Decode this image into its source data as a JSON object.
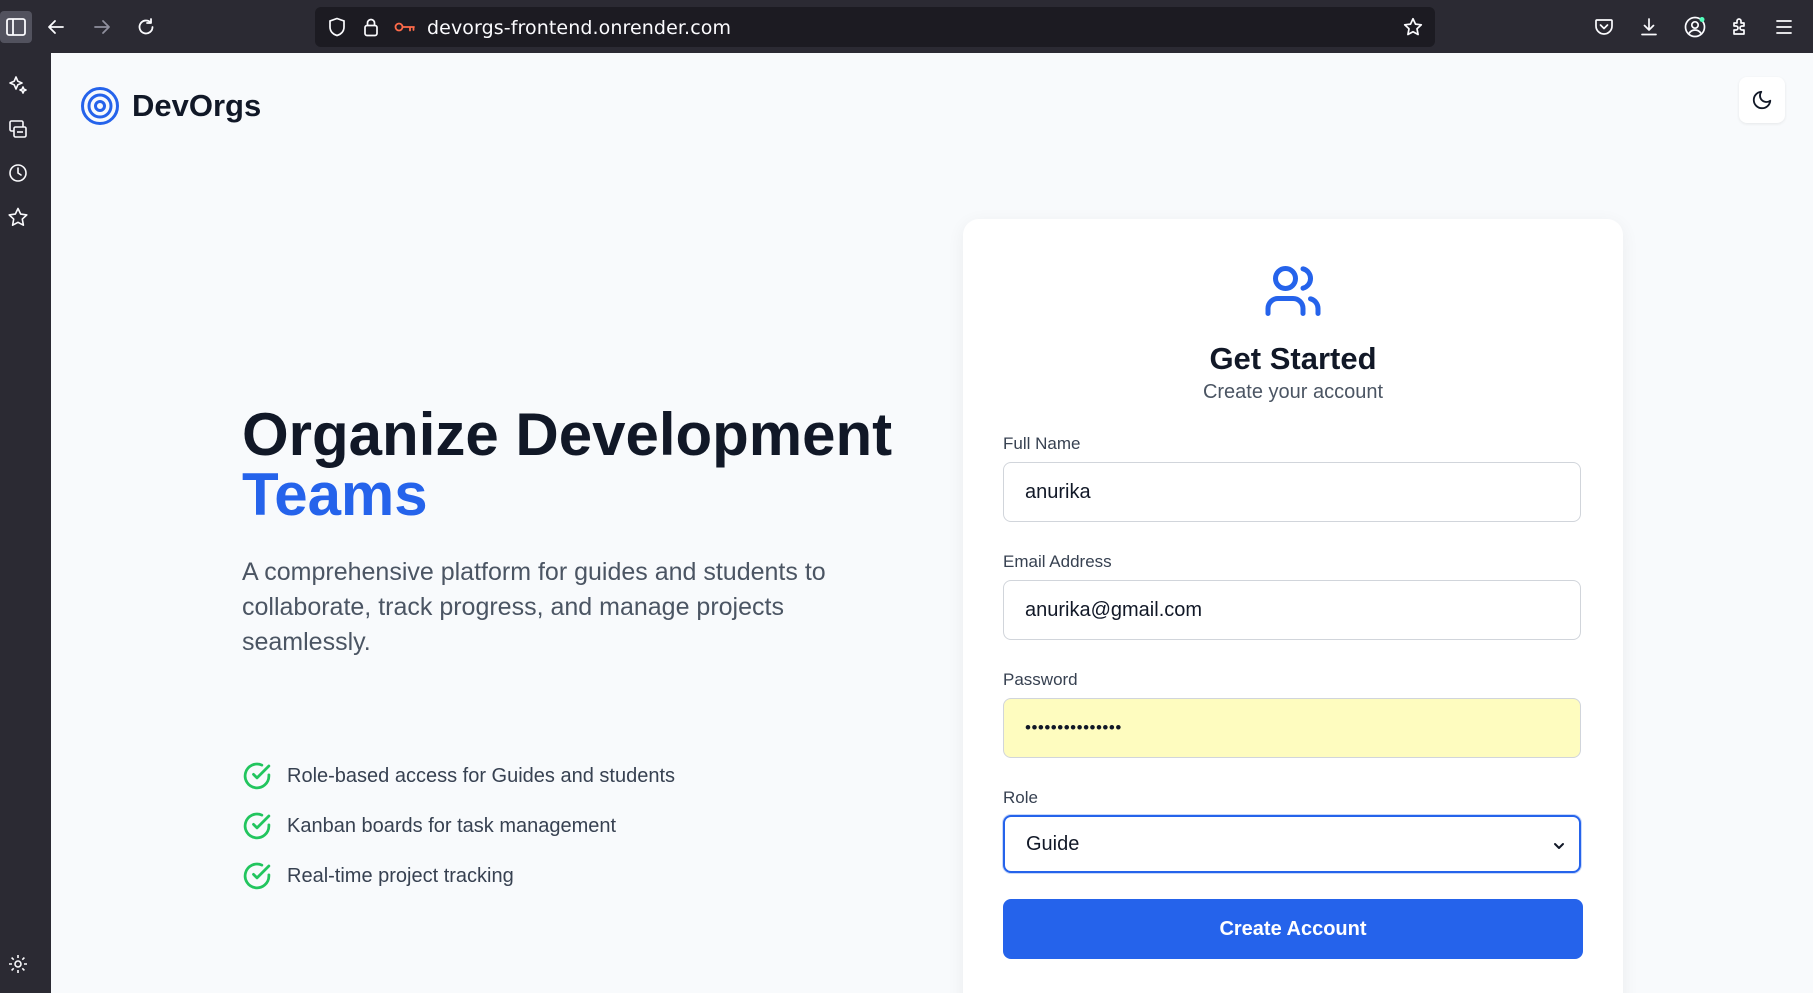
{
  "browser": {
    "url": "devorgs-frontend.onrender.com",
    "toolbar_icons": [
      "sidebar-toggle-icon",
      "back-arrow-icon",
      "forward-arrow-icon",
      "reload-icon",
      "shield-icon",
      "lock-icon",
      "key-icon",
      "bookmark-star-icon",
      "pocket-icon",
      "download-icon",
      "account-icon",
      "extensions-icon",
      "menu-icon"
    ],
    "sidebar_icons": [
      "ai-sparkle-icon",
      "synced-tabs-icon",
      "history-icon",
      "bookmarks-icon",
      "settings-icon"
    ]
  },
  "brand": {
    "name": "DevOrgs"
  },
  "hero": {
    "title_line1": "Organize Development",
    "title_line2": "Teams",
    "description": "A comprehensive platform for guides and students to collaborate, track progress, and manage projects seamlessly.",
    "features": [
      "Role-based access for Guides and students",
      "Kanban boards for task management",
      "Real-time project tracking"
    ]
  },
  "form": {
    "title": "Get Started",
    "subtitle": "Create your account",
    "full_name_label": "Full Name",
    "full_name_value": "anurika",
    "email_label": "Email Address",
    "email_value": "anurika@gmail.com",
    "password_label": "Password",
    "password_value": "•••••••••••••••",
    "role_label": "Role",
    "role_value": "Guide",
    "submit_label": "Create Account"
  },
  "colors": {
    "accent": "#2563eb",
    "check_green": "#22c55e",
    "heading": "#111827",
    "autofill_bg": "#fefcbf",
    "browser_chrome": "#2b2a33"
  }
}
